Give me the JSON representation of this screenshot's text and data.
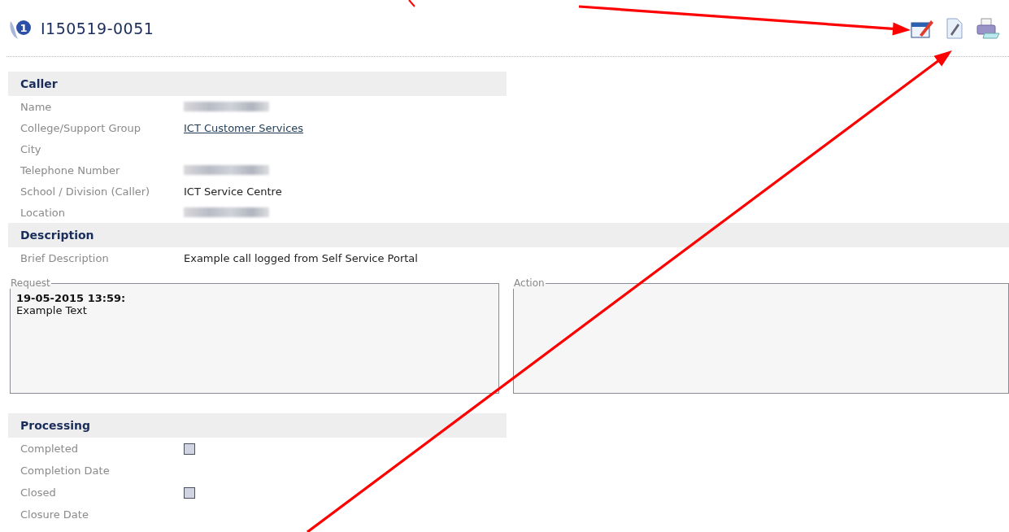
{
  "header": {
    "badge": "1",
    "title": "I150519-0051"
  },
  "sections": [
    {
      "title": "Caller",
      "wide": false,
      "fields": [
        {
          "label": "Name",
          "kind": "redacted"
        },
        {
          "label": "College/Support Group",
          "kind": "link",
          "value": "ICT Customer Services"
        },
        {
          "label": "City",
          "kind": "text"
        },
        {
          "label": "Telephone Number",
          "kind": "redacted"
        },
        {
          "label": "School / Division (Caller)",
          "kind": "text",
          "value": "ICT Service Centre"
        },
        {
          "label": "Location",
          "kind": "redacted"
        }
      ]
    },
    {
      "title": "Description",
      "wide": true,
      "fields": [
        {
          "label": "Brief Description",
          "kind": "text",
          "value": "Example call logged from Self Service Portal"
        }
      ]
    }
  ],
  "request": {
    "legend": "Request",
    "timestamp": "19-05-2015 13:59:",
    "text": "Example Text"
  },
  "action": {
    "legend": "Action"
  },
  "processing": {
    "title": "Processing",
    "fields": [
      {
        "label": "Completed",
        "kind": "checkbox",
        "checked": false
      },
      {
        "label": "Completion Date",
        "kind": "text"
      },
      {
        "label": "Closed",
        "kind": "checkbox",
        "checked": false
      },
      {
        "label": "Closure Date",
        "kind": "text"
      }
    ]
  }
}
